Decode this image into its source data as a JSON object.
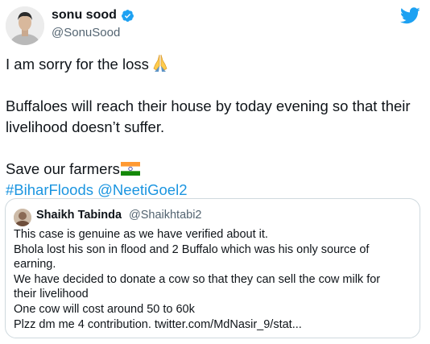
{
  "author": {
    "display_name": "sonu sood",
    "handle": "@SonuSood",
    "verified_icon": "verified-badge-icon",
    "avatar_icon": "profile-avatar"
  },
  "brand_icon": "twitter-bird-icon",
  "colors": {
    "link": "#1b95e0",
    "brand": "#1da1f2",
    "text": "#0f1419",
    "secondary": "#536471",
    "border": "#cfd9de"
  },
  "tweet": {
    "line1": "I am sorry for the loss",
    "line1_emoji": "folded-hands-icon",
    "line2": "Buffaloes will reach their house by today evening so that their",
    "line3": "livelihood doesn’t suffer.",
    "line4": "Save our farmers",
    "line4_emoji": "india-flag-icon",
    "hashtag": "#BiharFloods",
    "mention": "@NeetiGoel2"
  },
  "quoted_tweet": {
    "display_name": "Shaikh Tabinda",
    "handle": "@Shaikhtabi2",
    "lines": [
      "This case is genuine as we have verified about it.",
      "Bhola lost his son in flood and 2 Buffalo which was his only source of",
      "earning.",
      "We have decided to donate a cow so that they can sell the cow milk for",
      "their livelihood",
      "One cow will cost around 50 to 60k",
      "Plzz dm me 4 contribution. twitter.com/MdNasir_9/stat..."
    ]
  }
}
